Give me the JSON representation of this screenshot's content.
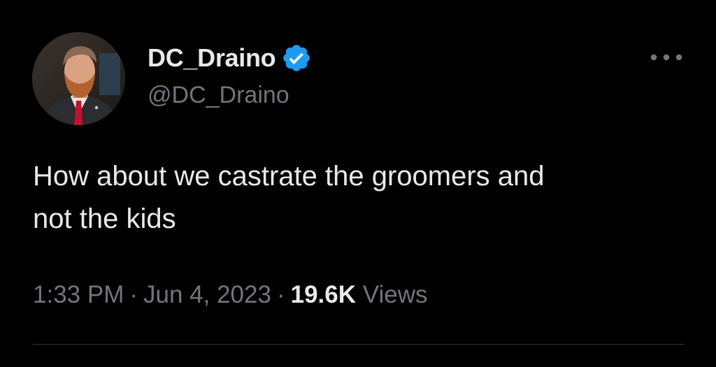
{
  "author": {
    "display_name": "DC_Draino",
    "handle": "@DC_Draino",
    "verified": true,
    "verified_icon": "verified-badge-icon",
    "avatar": "profile-photo"
  },
  "tweet": {
    "text": "How about we castrate the groomers and\nnot the kids",
    "time": "1:33 PM",
    "date": "Jun 4, 2023",
    "separator": "·",
    "views_count": "19.6K",
    "views_label": "Views"
  },
  "more_icon": "more-horizontal-icon",
  "colors": {
    "background": "#000000",
    "primary_text": "#e7e9ea",
    "secondary_text": "#71767b",
    "verified_blue": "#1d9bf0",
    "divider": "#2f3336"
  }
}
